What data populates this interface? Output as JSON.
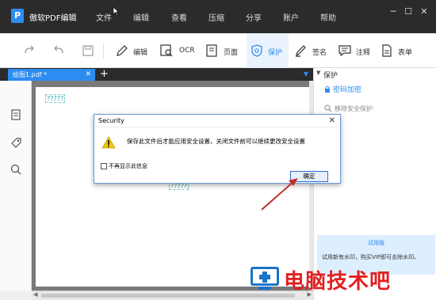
{
  "titlebar": {
    "app_name": "傲软PDF编辑",
    "menus": [
      "文件",
      "编辑",
      "查看",
      "压缩",
      "分享",
      "账户",
      "帮助"
    ]
  },
  "toolbar": {
    "items": [
      {
        "label": "编辑",
        "icon": "pen-edit-icon"
      },
      {
        "label": "OCR",
        "icon": "ocr-scan-icon"
      },
      {
        "label": "页面",
        "icon": "page-icon"
      },
      {
        "label": "保护",
        "icon": "shield-icon",
        "active": true
      },
      {
        "label": "签名",
        "icon": "signature-pen-icon"
      },
      {
        "label": "注释",
        "icon": "comment-icon"
      },
      {
        "label": "表单",
        "icon": "form-icon"
      }
    ]
  },
  "tabs": {
    "active_label": "绘图1.pdf *",
    "add": "+"
  },
  "document": {
    "text1": "?????",
    "text2": "?????"
  },
  "right_panel": {
    "title": "保护",
    "item_password": "密码加密",
    "item_remove": "移除安全保护",
    "trial_title": "试用版",
    "trial_text": "试用新有水印，购买VIP即可去除水印。"
  },
  "dialog": {
    "title": "Security",
    "message": "保存此文件后才能应用安全设置，关闭文件前可以继续更改安全设置",
    "checkbox_label": "不再显示此信息",
    "ok_label": "确定"
  },
  "watermark": {
    "text": "电脑技术吧"
  },
  "colors": {
    "accent": "#2d8cf0",
    "titlebar": "#2b2b2b",
    "arrow": "#c0302a",
    "watermark": "#e02020"
  }
}
